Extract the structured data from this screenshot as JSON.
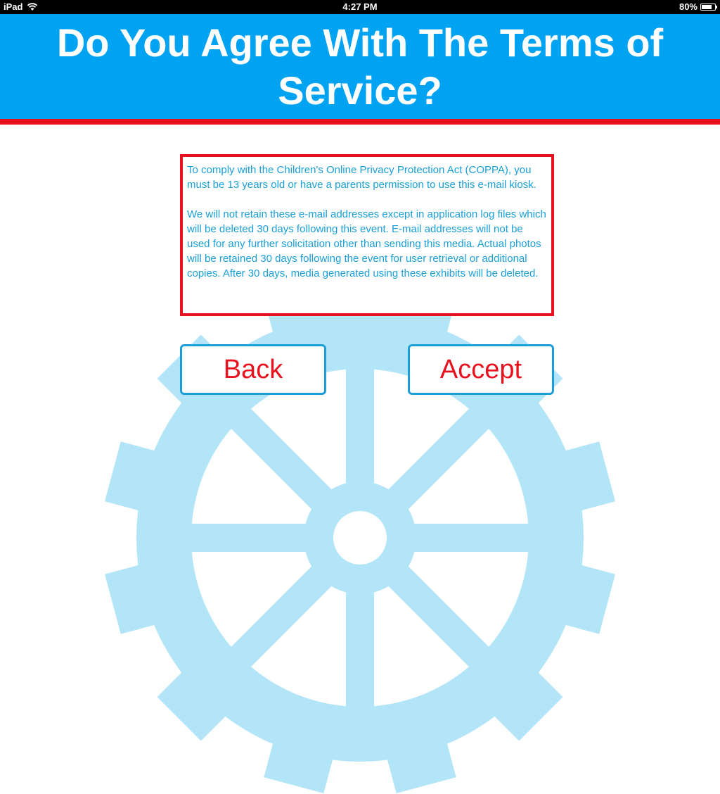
{
  "status_bar": {
    "carrier": "iPad",
    "time": "4:27 PM",
    "battery_percent": "80%",
    "battery_level": 0.8,
    "icons": [
      "wifi-icon",
      "battery-icon"
    ]
  },
  "header": {
    "title": "Do You Agree With The Terms of Service?"
  },
  "terms": {
    "paragraph_1": "To comply with the Children's Online Privacy Protection Act (COPPA), you must be 13 years old or have a parents permission to use this e-mail kiosk.",
    "paragraph_2": "We will not retain these e-mail addresses except in application log files which will be deleted 30 days following this event. E-mail addresses will not be used for any further solicitation other than sending this media. Actual photos will be retained 30 days following the event for user retrieval or additional copies. After 30 days, media generated using these exhibits will be deleted."
  },
  "buttons": {
    "back_label": "Back",
    "accept_label": "Accept"
  },
  "colors": {
    "header_blue": "#00a2f2",
    "accent_red": "#e8111d",
    "text_blue": "#1a9fd8",
    "gear_light_blue": "#b3e5f8"
  }
}
